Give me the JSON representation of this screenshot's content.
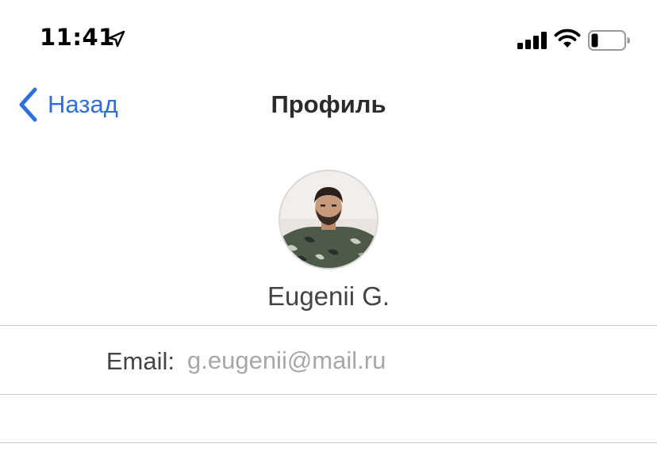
{
  "status_bar": {
    "time": "11:41",
    "icons": [
      "location-arrow-icon",
      "cellular-signal-icon",
      "wifi-icon",
      "battery-low-icon"
    ]
  },
  "nav": {
    "back_label": "Назад",
    "title": "Профиль"
  },
  "profile": {
    "name": "Eugenii G.",
    "avatar": "user-photo-avatar"
  },
  "fields": {
    "email": {
      "label": "Email:",
      "value": "g.eugenii@mail.ru"
    }
  },
  "colors": {
    "accent": "#2e6fe0",
    "title_text": "#2b2b2b",
    "secondary_text": "#a7a7ab",
    "separator": "#c8c8cc"
  }
}
